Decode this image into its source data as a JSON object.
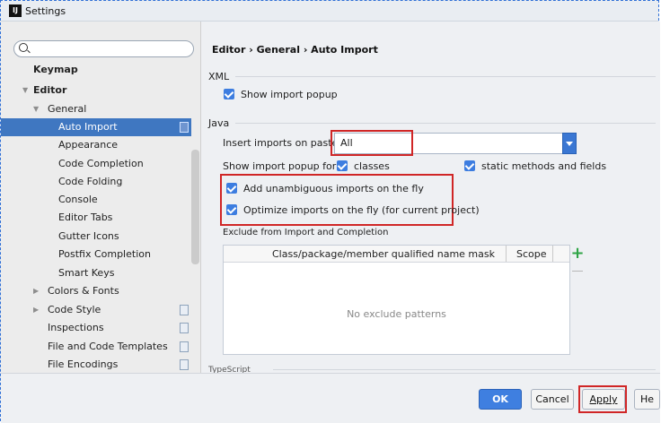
{
  "window": {
    "title": "Settings",
    "app_badge": "IJ"
  },
  "sidebar": {
    "search_placeholder": "",
    "items": [
      {
        "label": "Keymap"
      },
      {
        "label": "Editor"
      },
      {
        "label": "General"
      },
      {
        "label": "Auto Import"
      },
      {
        "label": "Appearance"
      },
      {
        "label": "Code Completion"
      },
      {
        "label": "Code Folding"
      },
      {
        "label": "Console"
      },
      {
        "label": "Editor Tabs"
      },
      {
        "label": "Gutter Icons"
      },
      {
        "label": "Postfix Completion"
      },
      {
        "label": "Smart Keys"
      },
      {
        "label": "Colors & Fonts"
      },
      {
        "label": "Code Style"
      },
      {
        "label": "Inspections"
      },
      {
        "label": "File and Code Templates"
      },
      {
        "label": "File Encodings"
      }
    ]
  },
  "breadcrumb": {
    "text": "Editor › General › Auto Import"
  },
  "xml": {
    "section": "XML",
    "show_import_popup": "Show import popup"
  },
  "java": {
    "section": "Java",
    "insert_imports_label": "Insert imports on paste:",
    "insert_imports_value": "All",
    "show_popup_for_label": "Show import popup for:",
    "classes_label": "classes",
    "static_label": "static methods and fields",
    "add_unambiguous": "Add unambiguous imports on the fly",
    "optimize_imports": "Optimize imports on the fly (for current project)",
    "exclude_section": "Exclude from Import and Completion"
  },
  "table": {
    "columns": [
      "Class/package/member qualified name mask",
      "Scope"
    ],
    "empty_text": "No exclude patterns"
  },
  "typescript_partial": "TypeScript",
  "buttons": {
    "ok": "OK",
    "cancel": "Cancel",
    "apply": "Apply",
    "help": "He"
  },
  "colors": {
    "accent": "#3f77c1",
    "highlight_box": "#d02626",
    "add_green": "#2ea445"
  }
}
